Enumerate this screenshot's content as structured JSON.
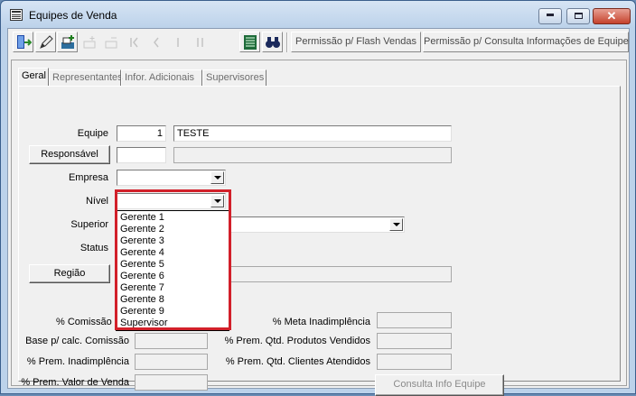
{
  "window": {
    "title": "Equipes de Venda",
    "controls": {
      "minimize": "–",
      "maximize": "□",
      "close": "✕"
    }
  },
  "toolbar": {
    "icons": [
      "exit-icon",
      "edit-icon",
      "add-icon",
      "add-disabled-icon",
      "remove-disabled-icon",
      "first-disabled-icon",
      "prev-disabled-icon",
      "next-disabled-icon",
      "last-disabled-icon",
      "report-icon",
      "search-icon"
    ],
    "buttons": {
      "flash": "Permissão p/ Flash Vendas",
      "consulta": "Permissão p/ Consulta Informações de Equipe"
    }
  },
  "tabs": [
    "Geral",
    "Representantes",
    "Infor. Adicionais",
    "Supervisores"
  ],
  "form": {
    "equipe_label": "Equipe",
    "equipe_code": "1",
    "equipe_name": "TESTE",
    "responsavel_button": "Responsável",
    "responsavel_code": "",
    "responsavel_name": "",
    "empresa_label": "Empresa",
    "empresa_value": "",
    "nivel_label": "Nível",
    "nivel_value": "",
    "superior_label": "Superior",
    "status_label": "Status",
    "regiao_button": "Região",
    "comissao_label": "% Comissão F",
    "base_label": "Base p/ calc. Comissão",
    "inadimplencia_label": "% Prem. Inadimplência",
    "valor_venda_label": "% Prem. Valor de Venda",
    "meta_label": "% Meta Inadimplência",
    "produtos_label": "% Prem. Qtd. Produtos Vendidos",
    "clientes_label": "% Prem. Qtd. Clientes Atendidos",
    "consulta_button": "Consulta Info Equipe"
  },
  "nivel_options": [
    "Gerente 1",
    "Gerente 2",
    "Gerente 3",
    "Gerente 4",
    "Gerente 5",
    "Gerente 6",
    "Gerente 7",
    "Gerente 8",
    "Gerente 9",
    "Supervisor"
  ],
  "colors": {
    "highlight": "#d2202a",
    "window_frame": "#bcd2ea"
  }
}
